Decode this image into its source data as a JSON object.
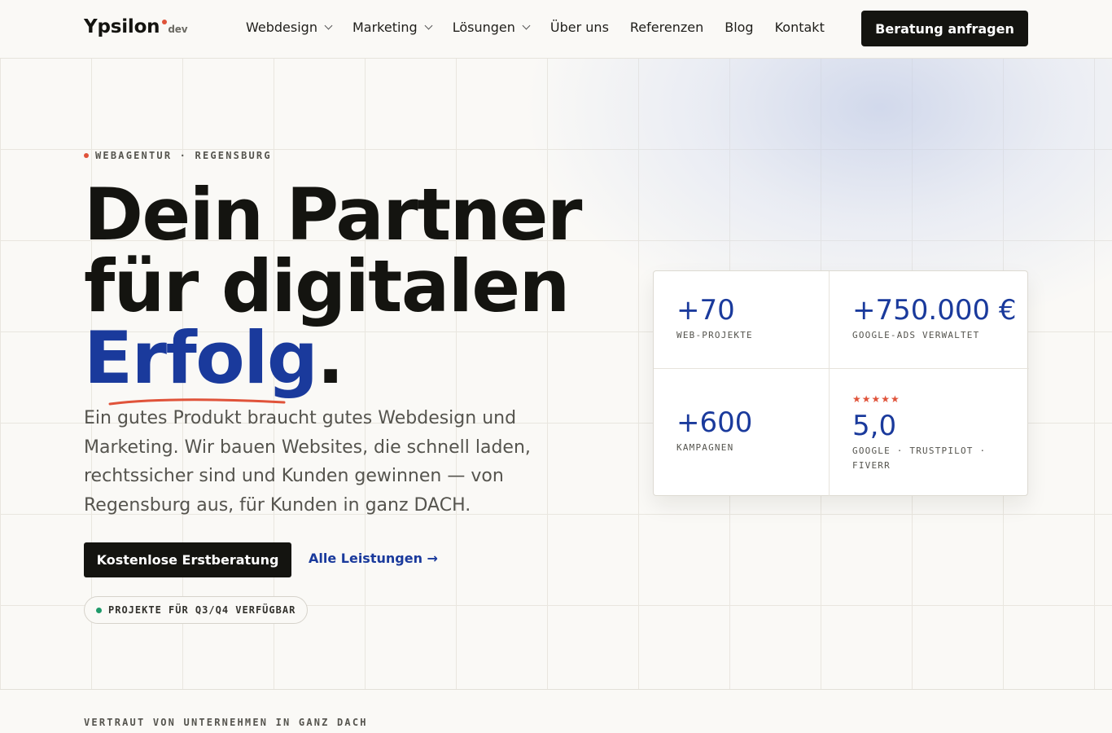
{
  "brand": {
    "name": "Ypsilon",
    "suffix": "dev"
  },
  "nav": {
    "items": [
      {
        "label": "Webdesign",
        "has_dropdown": true
      },
      {
        "label": "Marketing",
        "has_dropdown": true
      },
      {
        "label": "Lösungen",
        "has_dropdown": true
      },
      {
        "label": "Über uns",
        "has_dropdown": false
      },
      {
        "label": "Referenzen",
        "has_dropdown": false
      },
      {
        "label": "Blog",
        "has_dropdown": false
      },
      {
        "label": "Kontakt",
        "has_dropdown": false
      }
    ],
    "cta_label": "Beratung anfragen"
  },
  "hero": {
    "eyebrow": "WEBAGENTUR · REGENSBURG",
    "headline_line1": "Dein Partner",
    "headline_line2": "für digitalen",
    "headline_accent": "Erfolg",
    "headline_period": ".",
    "lead": "Ein gutes Produkt braucht gutes Webdesign und Marketing. Wir bauen Websites, die schnell laden, rechtssicher sind und Kunden gewinnen — von Regensburg aus, für Kunden in ganz DACH.",
    "primary_button": "Kostenlose Erstberatung",
    "secondary_link": "Alle Leistungen →",
    "availability": "PROJEKTE FÜR Q3/Q4 VERFÜGBAR"
  },
  "stats": [
    {
      "value": "+70",
      "label": "WEB-PROJEKTE"
    },
    {
      "value": "+750.000 €",
      "label": "GOOGLE-ADS VERWALTET"
    },
    {
      "value": "+600",
      "label": "KAMPAGNEN"
    },
    {
      "value": "5,0",
      "label": "GOOGLE · TRUSTPILOT · FIVERR",
      "stars": "★★★★★",
      "rating": 5
    }
  ],
  "trust": {
    "heading": "VERTRAUT VON UNTERNEHMEN IN GANZ DACH"
  },
  "colors": {
    "background": "#faf9f6",
    "ink": "#141410",
    "accent_blue": "#1a3a9c",
    "accent_orange": "#e0533a",
    "status_green": "#1f9a6a"
  },
  "icons": [
    "chevron-down-icon",
    "arrow-right-icon",
    "star-icon",
    "status-dot-icon"
  ]
}
